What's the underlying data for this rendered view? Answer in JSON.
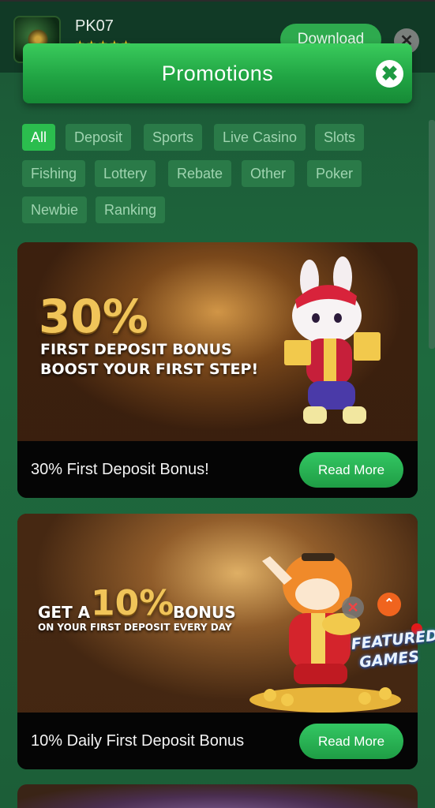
{
  "app_bar": {
    "name": "PK07",
    "stars": "★★★★★",
    "download_label": "Download",
    "close_glyph": "✕"
  },
  "promotions": {
    "title": "Promotions",
    "close_glyph": "✖"
  },
  "filters": [
    {
      "label": "All",
      "active": true
    },
    {
      "label": "Deposit",
      "active": false
    },
    {
      "label": "Sports",
      "active": false
    },
    {
      "label": "Live Casino",
      "active": false
    },
    {
      "label": "Slots",
      "active": false
    },
    {
      "label": "Fishing",
      "active": false
    },
    {
      "label": "Lottery",
      "active": false
    },
    {
      "label": "Rebate",
      "active": false
    },
    {
      "label": "Other",
      "active": false
    },
    {
      "label": "Poker",
      "active": false
    },
    {
      "label": "Newbie",
      "active": false
    },
    {
      "label": "Ranking",
      "active": false
    }
  ],
  "cards": [
    {
      "banner_big": "30%",
      "banner_line1": "FIRST DEPOSIT BONUS",
      "banner_line2": "BOOST YOUR FIRST STEP!",
      "title": "30% First Deposit Bonus!",
      "button": "Read More"
    },
    {
      "banner_pre": "GET A",
      "banner_big": "10%",
      "banner_post": "BONUS",
      "banner_line2": "ON YOUR FIRST DEPOSIT EVERY DAY",
      "title": "10% Daily First Deposit Bonus",
      "button": "Read More"
    }
  ],
  "floating": {
    "close_glyph": "✕",
    "up_glyph": "⌃",
    "featured_line1": "FEATURED",
    "featured_line2": "GAMES"
  },
  "colors": {
    "accent": "#2bbd4e",
    "background": "#1f5c3c",
    "chip": "#2a7a48",
    "banner_gold": "#f0c459"
  }
}
